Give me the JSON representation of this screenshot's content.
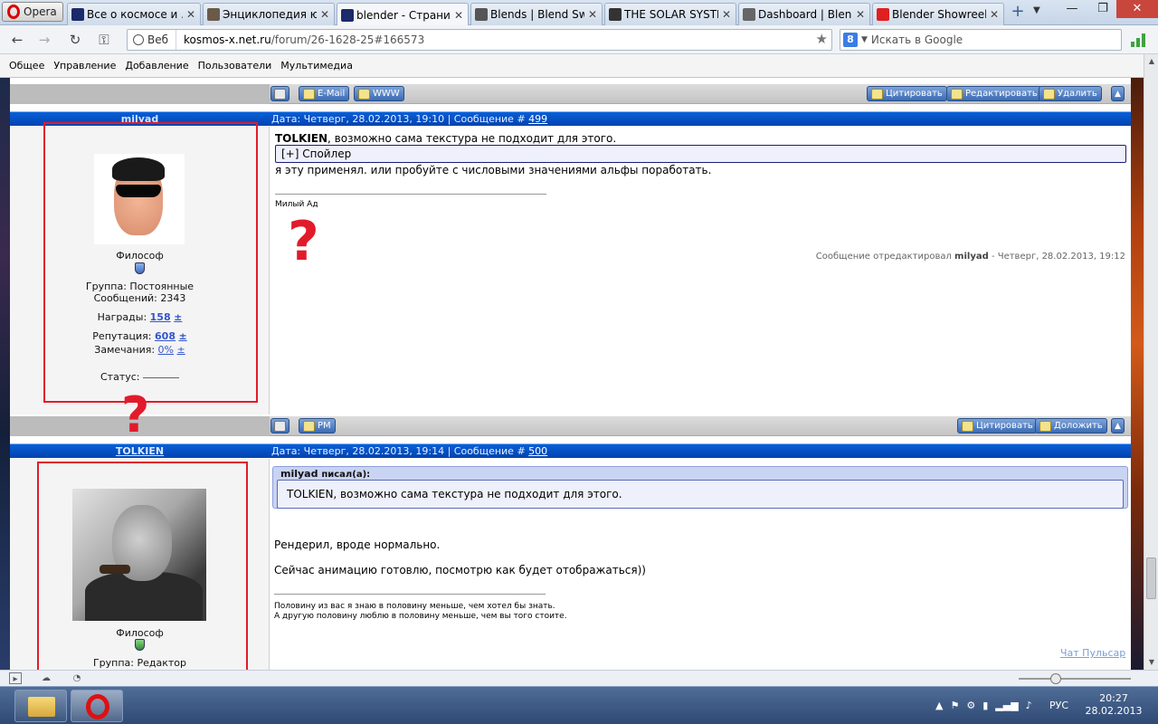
{
  "browser": {
    "menu_label": "Opera",
    "tabs": [
      {
        "title": "Все о космосе и ...",
        "color": "#1b2a6a"
      },
      {
        "title": "Энциклопедия ю...",
        "color": "#6b5a4a"
      },
      {
        "title": "blender - Страниц...",
        "color": "#1b2a6a",
        "active": true
      },
      {
        "title": "Blends | Blend Swap",
        "color": "#555555"
      },
      {
        "title": "THE SOLAR SYSTE...",
        "color": "#333333"
      },
      {
        "title": "Dashboard | Blend...",
        "color": "#666666"
      },
      {
        "title": "Blender Showreel ...",
        "color": "#e02020"
      }
    ],
    "address_badge": "Веб",
    "url_host": "kosmos-x.net.ru",
    "url_path": "/forum/26-1628-25#166573",
    "search_placeholder": "Искать в Google",
    "search_engine_letter": "8",
    "menu_items": [
      "Общее",
      "Управление",
      "Добавление",
      "Пользователи",
      "Мультимедиа"
    ]
  },
  "top_toolbar": {
    "email_label": "E-Mail",
    "www_label": "WWW",
    "quote_label": "Цитировать",
    "edit_label": "Редактировать",
    "delete_label": "Удалить"
  },
  "post1": {
    "username": "milyad",
    "date_prefix": "Дата: Четверг, 28.02.2013, 19:10 | Сообщение #",
    "number": "499",
    "profile": {
      "rank": "Философ",
      "group": "Группа: Постоянные",
      "messages": "Сообщений: 2343",
      "awards_label": "Награды:",
      "awards_value": "158",
      "reputation_label": "Репутация:",
      "reputation_value": "608",
      "warnings_label": "Замечания:",
      "warnings_value": "0%",
      "plusminus": "±",
      "status_label": "Статус:"
    },
    "addressee": "TOLKIEN",
    "text_first": ", возможно сама текстура не подходит для этого.",
    "spoiler": "[+] Спойлер",
    "text_second": "я эту применял. или пробуйте с числовыми значениями альфы поработать.",
    "signature": "Милый Ад",
    "edit_note_prefix": "Сообщение отредактировал",
    "edit_note_user": "milyad",
    "edit_note_suffix": "- Четверг, 28.02.2013, 19:12"
  },
  "mid_toolbar": {
    "pm_label": "PM",
    "quote_label": "Цитировать",
    "report_label": "Доложить"
  },
  "post2": {
    "username": "TOLKIEN",
    "date_prefix": "Дата: Четверг, 28.02.2013, 19:14 | Сообщение #",
    "number": "500",
    "profile": {
      "rank": "Философ",
      "group": "Группа: Редактор"
    },
    "quote_author": "milyad",
    "quote_wrote": "писал(а):",
    "quote_text": "TOLKIEN, возможно сама текстура не подходит для этого.",
    "line1": "Рендерил, вроде нормально.",
    "line2": "Сейчас анимацию готовлю, посмотрю как будет отображаться))",
    "sig1": "Половину из вас я знаю в половину меньше, чем хотел бы знать.",
    "sig2": "А другую половину люблю в половину меньше, чем вы того стоите."
  },
  "annotations": {
    "question_mark": "?",
    "accent": "#e21b2b"
  },
  "chat_link": "Чат Пульсар",
  "taskbar": {
    "language": "РУС",
    "time": "20:27",
    "date": "28.02.2013"
  }
}
